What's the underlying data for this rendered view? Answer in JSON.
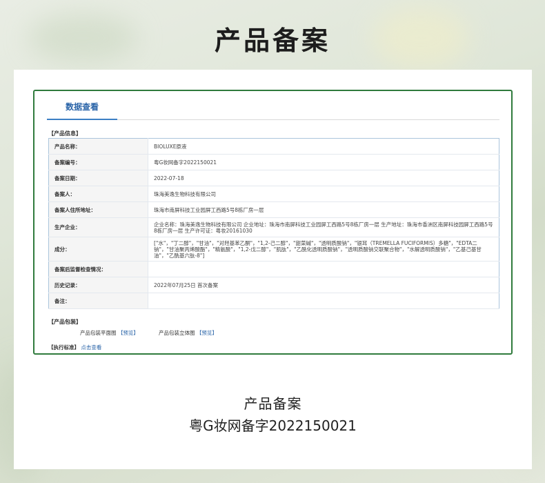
{
  "page_title": "产品备案",
  "tab_label": "数据查看",
  "sections": {
    "product_info": "【产品信息】",
    "packaging": "【产品包装】",
    "standard": "【执行标准】"
  },
  "rows": [
    {
      "key": "产品名称：",
      "value": "BIOLUXE原液"
    },
    {
      "key": "备案编号：",
      "value": "粤G妆网备字2022150021"
    },
    {
      "key": "备案日期：",
      "value": "2022-07-18"
    },
    {
      "key": "备案人：",
      "value": "珠海美逸生物科技有限公司"
    },
    {
      "key": "备案人住所地址：",
      "value": "珠海市南屏科技工业园屏工西路5号8栋厂房一层"
    },
    {
      "key": "生产企业：",
      "value": "企业名称：珠海美逸生物科技有限公司 企业地址：珠海市南屏科技工业园屏工西路5号8栋厂房一层 生产地址：珠海市香洲区南屏科技园屏工西路5号8栋厂房一层 生产许可证：粤妆20161030"
    },
    {
      "key": "成分：",
      "value": "[\"水\"，\"丁二醇\"，\"甘油\"，\"对羟基苯乙酮\"，\"1,2-己二醇\"，\"甜菜碱\"，\"透明质酸钠\"，\"银耳（TREMELLA FUCIFORMIS）多糖\"，\"EDTA二钠\"，\"甘油聚丙烯酸酯\"，\"精氨酸\"，\"1,2-戊二醇\"，\"肌肽\"，\"乙酰化透明质酸钠\"，\"透明质酸钠交联聚合物\"，\"水解透明质酸钠\"，\"乙基己基甘油\"，\"乙酰基六肽-8\"]"
    },
    {
      "key": "备案后监督检查情况：",
      "value": ""
    },
    {
      "key": "历史记录：",
      "value": "2022年07月25日 首次备案"
    },
    {
      "key": "备注：",
      "value": ""
    }
  ],
  "packaging": {
    "flat_label": "产品包装平面图",
    "solid_label": "产品包装立体图",
    "preview_link": "【预览】"
  },
  "standard_link": "点击查看",
  "footer": {
    "line1": "产品备案",
    "line2": "粤G妆网备字2022150021"
  }
}
